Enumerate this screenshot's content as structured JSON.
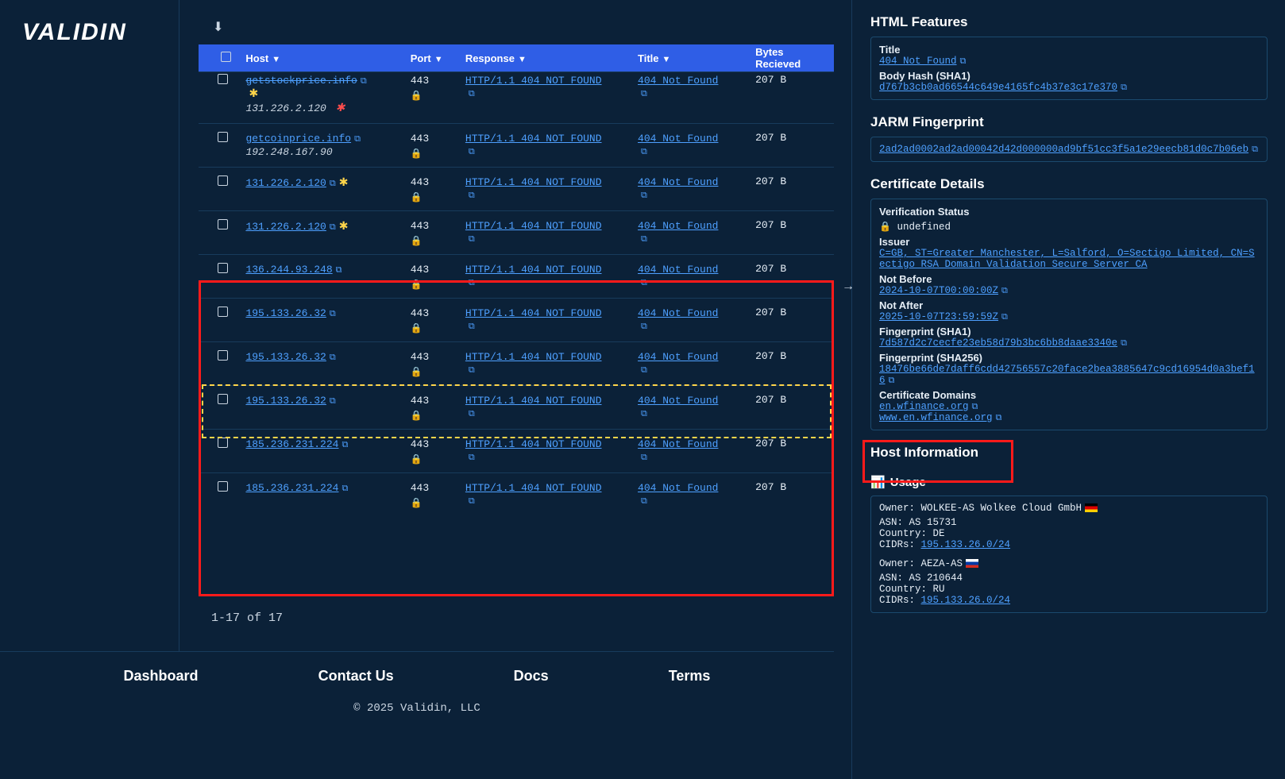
{
  "brand": "VALIDIN",
  "columns": {
    "host": "Host",
    "port": "Port",
    "response": "Response",
    "title": "Title",
    "bytes": "Bytes Recieved"
  },
  "rows": [
    {
      "truncated": true,
      "host": "getstockprice.info",
      "ip": "131.226.2.120",
      "ip_star": "red",
      "host_star": "yellow",
      "port": "443",
      "resp": "HTTP/1.1 404 NOT FOUND",
      "title": "404 Not Found",
      "bytes": "207 B"
    },
    {
      "host": "getcoinprice.info",
      "ip": "192.248.167.90",
      "port": "443",
      "resp": "HTTP/1.1 404 NOT FOUND",
      "title": "404 Not Found",
      "bytes": "207 B"
    },
    {
      "host": "131.226.2.120",
      "host_star": "yellow",
      "port": "443",
      "resp": "HTTP/1.1 404 NOT FOUND",
      "title": "404 Not Found",
      "bytes": "207 B"
    },
    {
      "host": "131.226.2.120",
      "host_star": "yellow",
      "port": "443",
      "resp": "HTTP/1.1 404 NOT FOUND",
      "title": "404 Not Found",
      "bytes": "207 B"
    },
    {
      "host": "136.244.93.248",
      "port": "443",
      "resp": "HTTP/1.1 404 NOT FOUND",
      "title": "404 Not Found",
      "bytes": "207 B"
    },
    {
      "host": "195.133.26.32",
      "port": "443",
      "resp": "HTTP/1.1 404 NOT FOUND",
      "title": "404 Not Found",
      "bytes": "207 B"
    },
    {
      "host": "195.133.26.32",
      "port": "443",
      "resp": "HTTP/1.1 404 NOT FOUND",
      "title": "404 Not Found",
      "bytes": "207 B"
    },
    {
      "host": "195.133.26.32",
      "port": "443",
      "resp": "HTTP/1.1 404 NOT FOUND",
      "title": "404 Not Found",
      "bytes": "207 B"
    },
    {
      "host": "185.236.231.224",
      "port": "443",
      "resp": "HTTP/1.1 404 NOT FOUND",
      "title": "404 Not Found",
      "bytes": "207 B"
    },
    {
      "host": "185.236.231.224",
      "port": "443",
      "resp": "HTTP/1.1 404 NOT FOUND",
      "title": "404 Not Found",
      "bytes": "207 B"
    }
  ],
  "pager": "1-17 of 17",
  "panel": {
    "html_features": {
      "heading": "HTML Features",
      "title_label": "Title",
      "title_value": "404 Not Found",
      "bodyhash_label": "Body Hash (SHA1)",
      "bodyhash_value": "d767b3cb0ad66544c649e4165fc4b37e3c17e370"
    },
    "jarm": {
      "heading": "JARM Fingerprint",
      "value": "2ad2ad0002ad2ad00042d42d000000ad9bf51cc3f5a1e29eecb81d0c7b06eb"
    },
    "cert": {
      "heading": "Certificate Details",
      "ver_label": "Verification Status",
      "ver_value": "undefined",
      "issuer_label": "Issuer",
      "issuer_value": "C=GB, ST=Greater Manchester, L=Salford, O=Sectigo Limited, CN=Sectigo RSA Domain Validation Secure Server CA",
      "nb_label": "Not Before",
      "nb_value": "2024-10-07T00:00:00Z",
      "na_label": "Not After",
      "na_value": "2025-10-07T23:59:59Z",
      "fp1_label": "Fingerprint (SHA1)",
      "fp1_value": "7d587d2c7cecfe23eb58d79b3bc6bb8daae3340e",
      "fp256_label": "Fingerprint (SHA256)",
      "fp256_value": "18476be66de7daff6cdd42756557c20face2bea3885647c9cd16954d0a3bef16",
      "dom_label": "Certificate Domains",
      "dom1": "en.wfinance.org",
      "dom2": "www.en.wfinance.org"
    },
    "host_info": {
      "heading": "Host Information",
      "usage_label": "Usage",
      "o1_owner": "Owner: WOLKEE-AS Wolkee Cloud GmbH",
      "o1_asn": "ASN: AS 15731",
      "o1_country": "Country: DE",
      "o1_cidr_label": "CIDRs: ",
      "o1_cidr": "195.133.26.0/24",
      "o2_owner": "Owner: AEZA-AS",
      "o2_asn": "ASN: AS 210644",
      "o2_country": "Country: RU",
      "o2_cidr_label": "CIDRs: ",
      "o2_cidr": "195.133.26.0/24"
    }
  },
  "footer": {
    "dashboard": "Dashboard",
    "contact": "Contact Us",
    "docs": "Docs",
    "terms": "Terms",
    "copyright": "© 2025 Validin, LLC"
  }
}
